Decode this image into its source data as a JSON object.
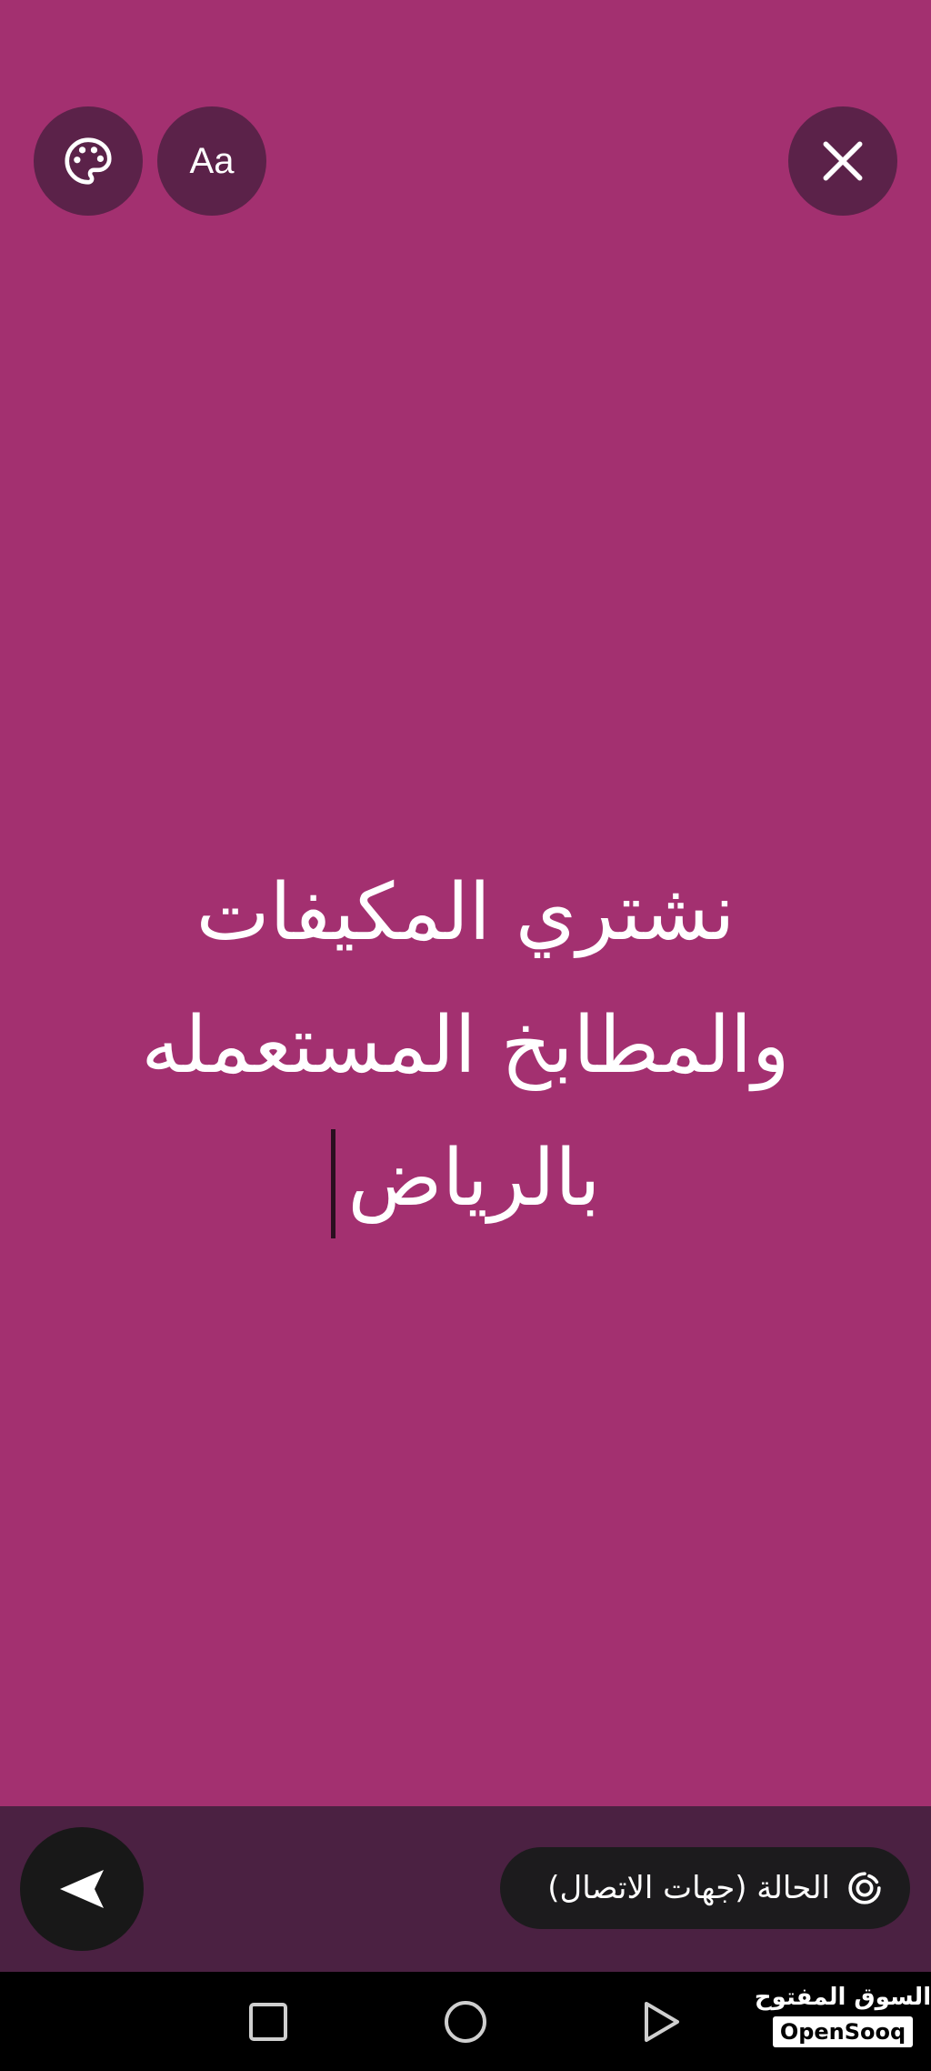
{
  "toolbar": {
    "font_button_label": "Aa",
    "palette_icon": "palette-icon",
    "close_icon": "close-icon"
  },
  "status": {
    "background_color": "#a33070",
    "text_lines": [
      "نشتري المكيفات",
      "والمطابخ المستعمله",
      "بالرياض"
    ]
  },
  "footer": {
    "audience_label": "الحالة (جهات الاتصال)",
    "audience_icon": "status-ring-icon",
    "send_icon": "send-icon"
  },
  "nav": {
    "recents_icon": "square-icon",
    "home_icon": "circle-icon",
    "back_icon": "triangle-back-icon"
  },
  "watermark": {
    "arabic": "السوق المفتوح",
    "latin": "OpenSooq"
  }
}
